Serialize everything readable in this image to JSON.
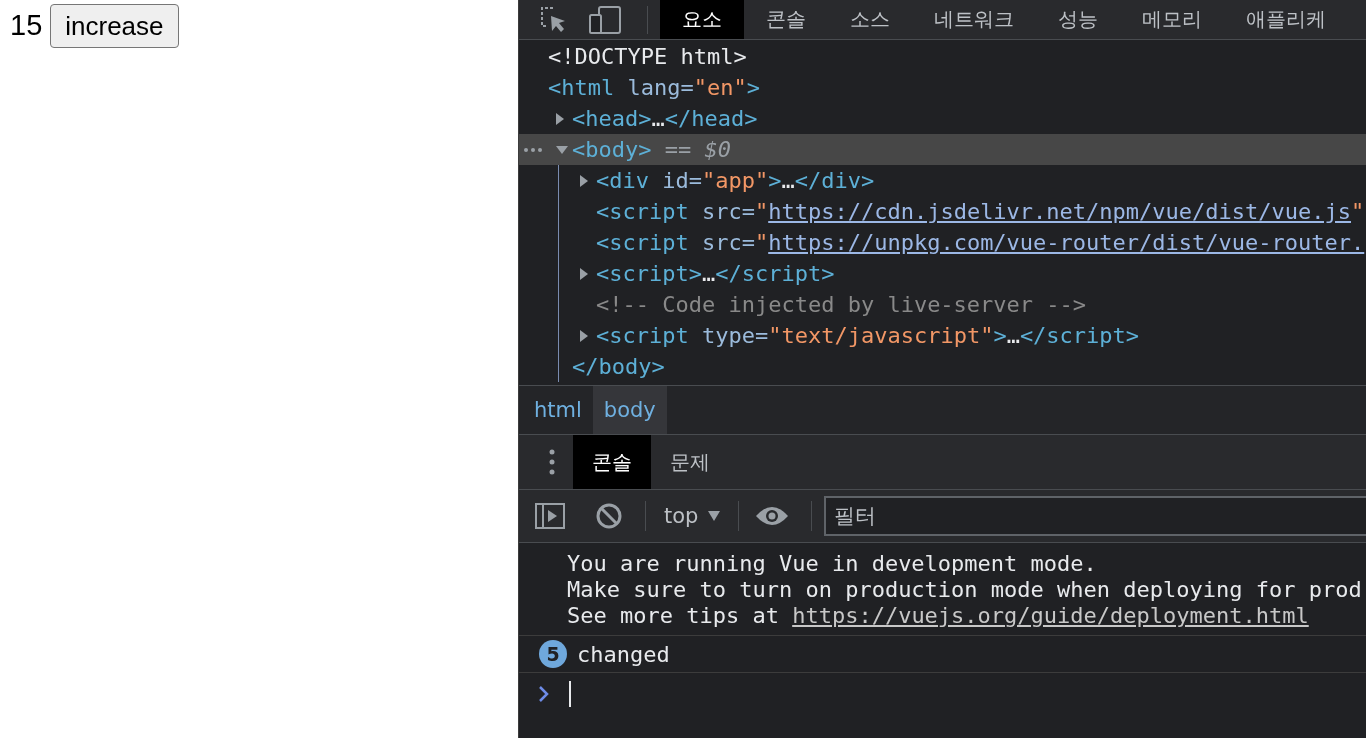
{
  "page": {
    "counter": "15",
    "button": "increase"
  },
  "devtools": {
    "tabs": [
      {
        "label": "요소",
        "selected": true
      },
      {
        "label": "콘솔",
        "selected": false
      },
      {
        "label": "소스",
        "selected": false
      },
      {
        "label": "네트워크",
        "selected": false
      },
      {
        "label": "성능",
        "selected": false
      },
      {
        "label": "메모리",
        "selected": false
      },
      {
        "label": "애플리케",
        "selected": false
      }
    ],
    "dom_tree": [
      {
        "selected": false,
        "tokens": [
          {
            "kind": "text",
            "text": "<!DOCTYPE html>"
          }
        ]
      },
      {
        "selected": false,
        "tokens": [
          {
            "kind": "tag",
            "text": "<html"
          },
          {
            "kind": "attr",
            "text": " lang="
          },
          {
            "kind": "val",
            "text": "\"en\""
          },
          {
            "kind": "tag",
            "text": ">"
          }
        ],
        "children": [
          {
            "expanded": false,
            "selected": false,
            "tokens": [
              {
                "kind": "tag",
                "text": "<head>"
              },
              {
                "kind": "text",
                "text": "…"
              },
              {
                "kind": "tag",
                "text": "</head>"
              }
            ]
          },
          {
            "expanded": true,
            "selected": true,
            "tokens": [
              {
                "kind": "tag",
                "text": "<body>"
              },
              {
                "kind": "dim",
                "text": " == $0"
              }
            ],
            "closing": [
              {
                "kind": "tag",
                "text": "</body>"
              }
            ],
            "children": [
              {
                "expanded": false,
                "selected": false,
                "tokens": [
                  {
                    "kind": "tag",
                    "text": "<div"
                  },
                  {
                    "kind": "attr",
                    "text": " id="
                  },
                  {
                    "kind": "val",
                    "text": "\"app\""
                  },
                  {
                    "kind": "tag",
                    "text": ">"
                  },
                  {
                    "kind": "text",
                    "text": "…"
                  },
                  {
                    "kind": "tag",
                    "text": "</div>"
                  }
                ]
              },
              {
                "selected": false,
                "tokens": [
                  {
                    "kind": "tag",
                    "text": "<script"
                  },
                  {
                    "kind": "attr",
                    "text": " src="
                  },
                  {
                    "kind": "val",
                    "text": "\""
                  },
                  {
                    "kind": "link",
                    "text": "https://cdn.jsdelivr.net/npm/vue/dist/vue.js"
                  },
                  {
                    "kind": "val",
                    "text": "\""
                  }
                ]
              },
              {
                "selected": false,
                "tokens": [
                  {
                    "kind": "tag",
                    "text": "<script"
                  },
                  {
                    "kind": "attr",
                    "text": " src="
                  },
                  {
                    "kind": "val",
                    "text": "\""
                  },
                  {
                    "kind": "link",
                    "text": "https://unpkg.com/vue-router/dist/vue-router."
                  }
                ]
              },
              {
                "expanded": false,
                "selected": false,
                "tokens": [
                  {
                    "kind": "tag",
                    "text": "<script>"
                  },
                  {
                    "kind": "text",
                    "text": "…"
                  },
                  {
                    "kind": "tag",
                    "text": "</script>"
                  }
                ]
              },
              {
                "selected": false,
                "tokens": [
                  {
                    "kind": "comment",
                    "text": "<!-- Code injected by live-server -->"
                  }
                ]
              },
              {
                "expanded": false,
                "selected": false,
                "tokens": [
                  {
                    "kind": "tag",
                    "text": "<script"
                  },
                  {
                    "kind": "attr",
                    "text": " type="
                  },
                  {
                    "kind": "val",
                    "text": "\"text/javascript\""
                  },
                  {
                    "kind": "tag",
                    "text": ">"
                  },
                  {
                    "kind": "text",
                    "text": "…"
                  },
                  {
                    "kind": "tag",
                    "text": "</script>"
                  }
                ]
              }
            ]
          }
        ]
      }
    ],
    "breadcrumbs": [
      {
        "label": "html",
        "selected": false
      },
      {
        "label": "body",
        "selected": true
      }
    ],
    "drawer_tabs": [
      {
        "label": "콘솔",
        "selected": true
      },
      {
        "label": "문제",
        "selected": false
      }
    ],
    "console_toolbar": {
      "context": "top",
      "filter_placeholder": "필터"
    },
    "messages": [
      {
        "kind": "log",
        "lines": [
          {
            "text": "You are running Vue in development mode."
          },
          {
            "text": "Make sure to turn on production mode when deploying for prod"
          },
          {
            "text": "See more tips at ",
            "link": "https://vuejs.org/guide/deployment.html"
          }
        ]
      },
      {
        "kind": "repeated",
        "count": "5",
        "text": "changed"
      }
    ]
  }
}
